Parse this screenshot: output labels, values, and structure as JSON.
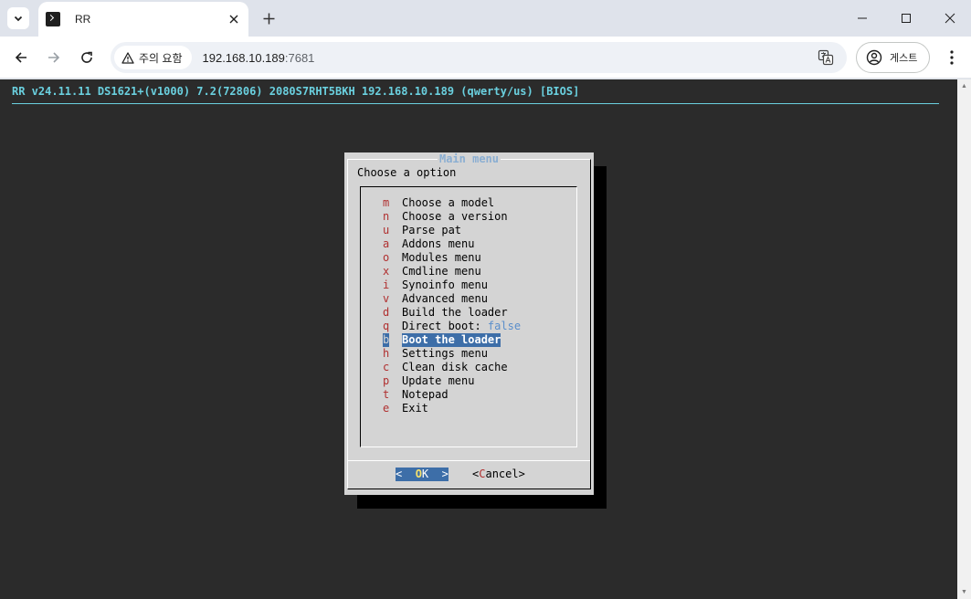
{
  "browser": {
    "tab": {
      "title": "RR"
    },
    "address": {
      "security_label": "주의 요함",
      "host": "192.168.10.189",
      "port": ":7681"
    },
    "profile": {
      "label": "게스트"
    }
  },
  "terminal": {
    "backtitle": "RR v24.11.11 DS1621+(v1000) 7.2(72806) 2080S7RHT5BKH 192.168.10.189 (qwerty/us) [BIOS]",
    "dialog": {
      "title": "Main menu",
      "prompt": "Choose a option",
      "items": [
        {
          "key": "m",
          "label": "Choose a model"
        },
        {
          "key": "n",
          "label": "Choose a version"
        },
        {
          "key": "u",
          "label": "Parse pat"
        },
        {
          "key": "a",
          "label": "Addons menu"
        },
        {
          "key": "o",
          "label": "Modules menu"
        },
        {
          "key": "x",
          "label": "Cmdline menu"
        },
        {
          "key": "i",
          "label": "Synoinfo menu"
        },
        {
          "key": "v",
          "label": "Advanced menu"
        },
        {
          "key": "d",
          "label": "Build the loader"
        },
        {
          "key": "q",
          "label": "Direct boot: ",
          "value": "false"
        },
        {
          "key": "b",
          "label": "Boot the loader",
          "selected": true
        },
        {
          "key": "h",
          "label": "Settings menu"
        },
        {
          "key": "c",
          "label": "Clean disk cache"
        },
        {
          "key": "p",
          "label": "Update menu"
        },
        {
          "key": "t",
          "label": "Notepad"
        },
        {
          "key": "e",
          "label": "Exit"
        }
      ],
      "buttons": {
        "ok": {
          "pre": "<  ",
          "hot": "O",
          "rest": "K",
          "post": "  >"
        },
        "cancel": {
          "pre": "<",
          "hot": "C",
          "rest": "ancel",
          "post": ">"
        }
      }
    }
  },
  "colors": {
    "terminal_bg": "#2b2b2b",
    "backtitle": "#6ad0df",
    "dialog_bg": "#d4d4d4",
    "hotkey": "#b03030",
    "selection_bg": "#3d6ea8",
    "title_text": "#8aaed2"
  },
  "icons": [
    "tab-search-icon",
    "terminal-icon",
    "close-icon",
    "plus-icon",
    "minimize-icon",
    "maximize-icon",
    "back-icon",
    "forward-icon",
    "reload-icon",
    "warning-icon",
    "translate-icon",
    "account-icon",
    "more-vert-icon"
  ]
}
